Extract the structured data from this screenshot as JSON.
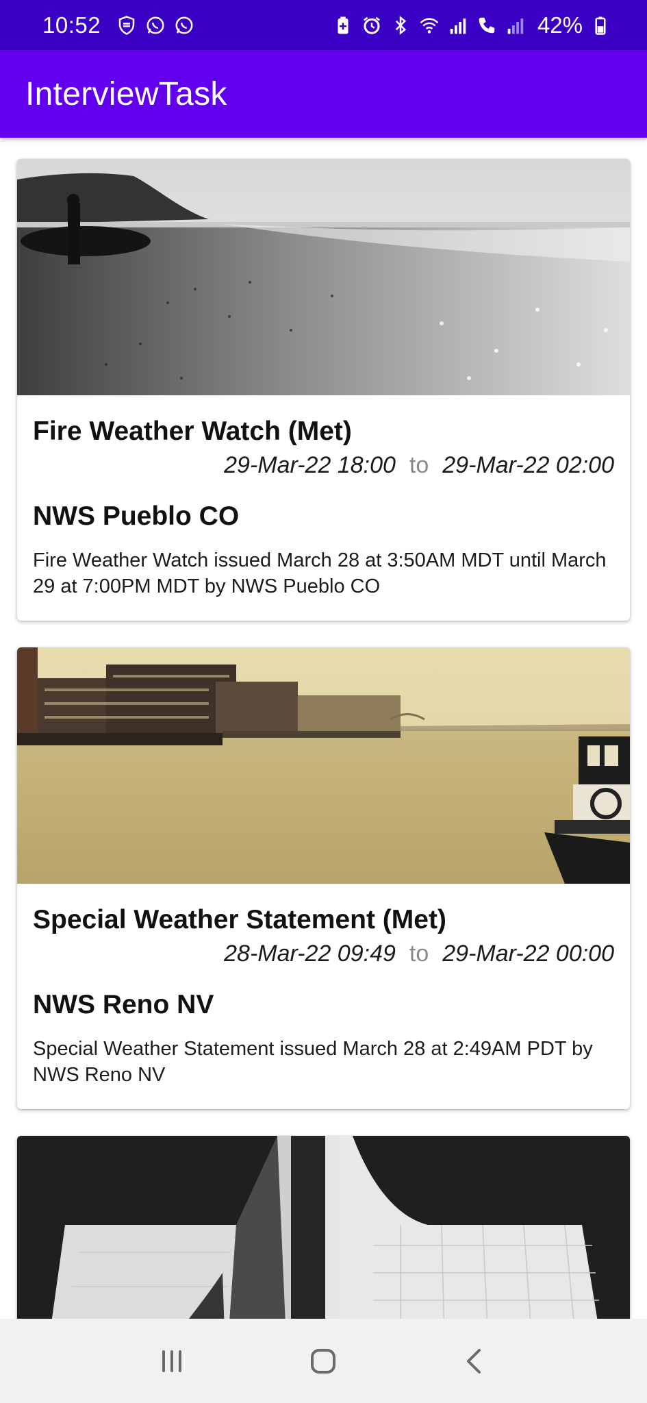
{
  "status_bar": {
    "time": "10:52",
    "battery_text": "42%",
    "left_icons": [
      "shield-icon",
      "whatsapp-icon",
      "whatsapp-icon"
    ],
    "right_icons": [
      "battery-saver-icon",
      "alarm-icon",
      "bluetooth-icon",
      "wifi-icon",
      "signal-icon",
      "volte-call-icon",
      "signal-weak-icon",
      "battery-icon"
    ]
  },
  "app_bar": {
    "title": "InterviewTask",
    "color": "#6200ee"
  },
  "cards": [
    {
      "title": "Fire Weather Watch (Met)",
      "start": "29-Mar-22 18:00",
      "separator": "to",
      "end": "29-Mar-22 02:00",
      "sender": "NWS Pueblo CO",
      "description": "Fire Weather Watch issued March 28 at 3:50AM MDT until March 29 at 7:00PM MDT by NWS Pueblo CO"
    },
    {
      "title": "Special Weather Statement (Met)",
      "start": "28-Mar-22 09:49",
      "separator": "to",
      "end": "29-Mar-22 00:00",
      "sender": "NWS Reno NV",
      "description": "Special Weather Statement issued March 28 at 2:49AM PDT by NWS Reno NV"
    }
  ],
  "nav_bar": {
    "buttons": [
      "recents-icon",
      "home-icon",
      "back-icon"
    ]
  }
}
